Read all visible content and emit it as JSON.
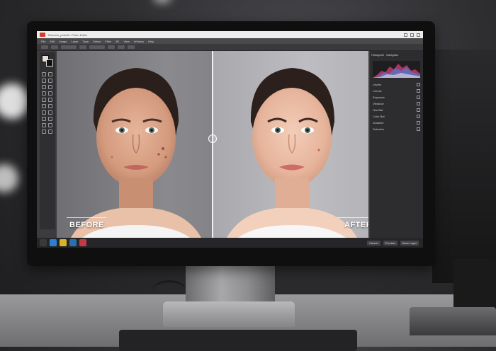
{
  "window": {
    "title": "Retouch_portrait - Photo Editor",
    "accent_color": "#d63a2c"
  },
  "menu": [
    "File",
    "Edit",
    "Image",
    "Layer",
    "Type",
    "Select",
    "Filter",
    "3D",
    "View",
    "Window",
    "Help"
  ],
  "canvas": {
    "before_label": "BEFORE",
    "after_label": "AFTER"
  },
  "panels": {
    "tabs": [
      "Histogram",
      "Navigator"
    ],
    "adjustments": [
      "Levels",
      "Curves",
      "Exposure",
      "Vibrance",
      "Hue/Sat",
      "Color Bal",
      "Gradient",
      "Selective"
    ]
  },
  "status": {
    "buttons": [
      "Cancel",
      "Preview",
      "Save Layer"
    ]
  },
  "icons": [
    "minimize-icon",
    "maximize-icon",
    "close-icon",
    "app-icon",
    "file-icon",
    "photoshop-icon",
    "image-icon",
    "gallery-icon"
  ]
}
